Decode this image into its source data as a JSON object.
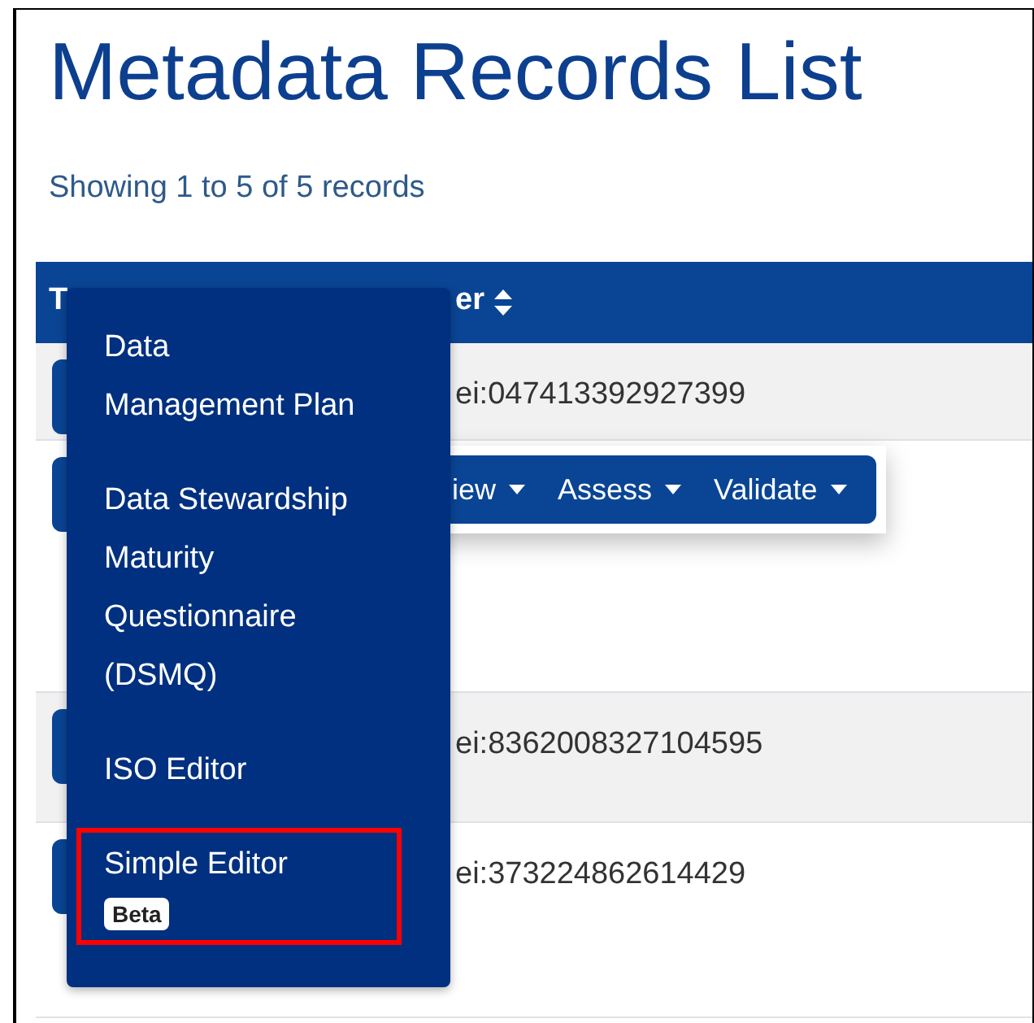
{
  "title": "Metadata Records List",
  "summary": "Showing 1 to 5 of 5 records",
  "table": {
    "columns": [
      {
        "label": "T"
      },
      {
        "label": "er",
        "sortable": true
      }
    ],
    "rows": [
      {
        "identifier": "ei:047413392927399"
      },
      {},
      {
        "identifier": "ei:8362008327104595"
      },
      {
        "identifier": "ei:373224862614429"
      }
    ]
  },
  "action_bar": {
    "buttons": [
      "iew",
      "Assess",
      "Validate"
    ]
  },
  "menu": {
    "items": [
      {
        "label": "Data\nManagement Plan",
        "highlighted": false
      },
      {
        "label": "Data Stewardship Maturity Questionnaire (DSMQ)",
        "highlighted": false
      },
      {
        "label": "ISO Editor",
        "highlighted": false
      },
      {
        "label": "Simple Editor",
        "badge": "Beta",
        "highlighted": true
      }
    ]
  }
}
